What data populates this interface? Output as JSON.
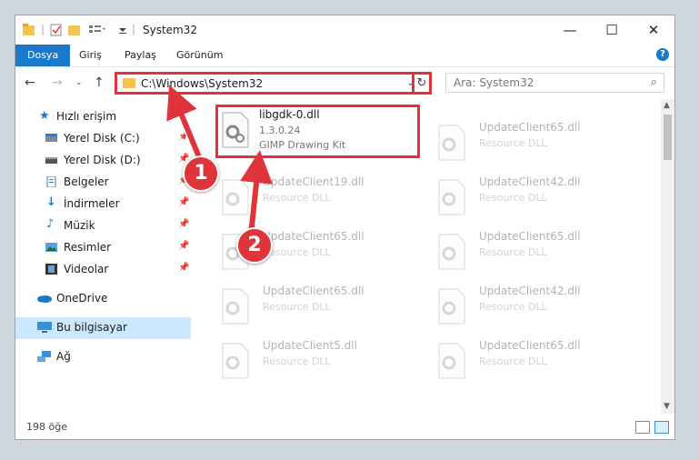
{
  "window": {
    "title": "System32",
    "minimize": "—",
    "maximize": "☐",
    "close": "✕"
  },
  "ribbon": {
    "tabs": [
      "Dosya",
      "Giriş",
      "Paylaş",
      "Görünüm"
    ],
    "help": "?"
  },
  "address": {
    "path": "C:\\Windows\\System32",
    "search_placeholder": "Ara: System32"
  },
  "sidebar": {
    "items": [
      {
        "label": "Hızlı erişim",
        "icon": "star-icon",
        "pinned": false
      },
      {
        "label": "Yerel Disk (C:)",
        "icon": "drive-icon",
        "pinned": true
      },
      {
        "label": "Yerel Disk (D:)",
        "icon": "drive-icon",
        "pinned": true
      },
      {
        "label": "Belgeler",
        "icon": "documents-icon",
        "pinned": true
      },
      {
        "label": "İndirmeler",
        "icon": "download-icon",
        "pinned": true
      },
      {
        "label": "Müzik",
        "icon": "music-icon",
        "pinned": true
      },
      {
        "label": "Resimler",
        "icon": "pictures-icon",
        "pinned": true
      },
      {
        "label": "Videolar",
        "icon": "videos-icon",
        "pinned": true
      },
      {
        "label": "OneDrive",
        "icon": "cloud-icon",
        "pinned": false
      },
      {
        "label": "Bu bilgisayar",
        "icon": "computer-icon",
        "pinned": false
      },
      {
        "label": "Ağ",
        "icon": "network-icon",
        "pinned": false
      }
    ]
  },
  "files": [
    {
      "name": "libgdk-0.dll",
      "version": "1.3.0.24",
      "description": "GIMP Drawing Kit"
    },
    {
      "name": "UpdateClient65.dll",
      "description": "Resource DLL"
    },
    {
      "name": "UpdateClient19.dll",
      "description": "Resource DLL"
    },
    {
      "name": "UpdateClient42.dll",
      "description": "Resource DLL"
    },
    {
      "name": "UpdateClient65.dll",
      "description": "Resource DLL"
    },
    {
      "name": "UpdateClient65.dll",
      "description": "Resource DLL"
    },
    {
      "name": "UpdateClient65.dll",
      "description": "Resource DLL"
    },
    {
      "name": "UpdateClient42.dll",
      "description": "Resource DLL"
    },
    {
      "name": "UpdateClient5.dll",
      "description": "Resource DLL"
    },
    {
      "name": "UpdateClient65.dll",
      "description": "Resource DLL"
    }
  ],
  "status": {
    "count": "198 öğe"
  },
  "callouts": [
    "1",
    "2"
  ],
  "colors": {
    "accent": "#1979ca",
    "highlight": "#e0343c",
    "selection": "#cce8ff"
  }
}
